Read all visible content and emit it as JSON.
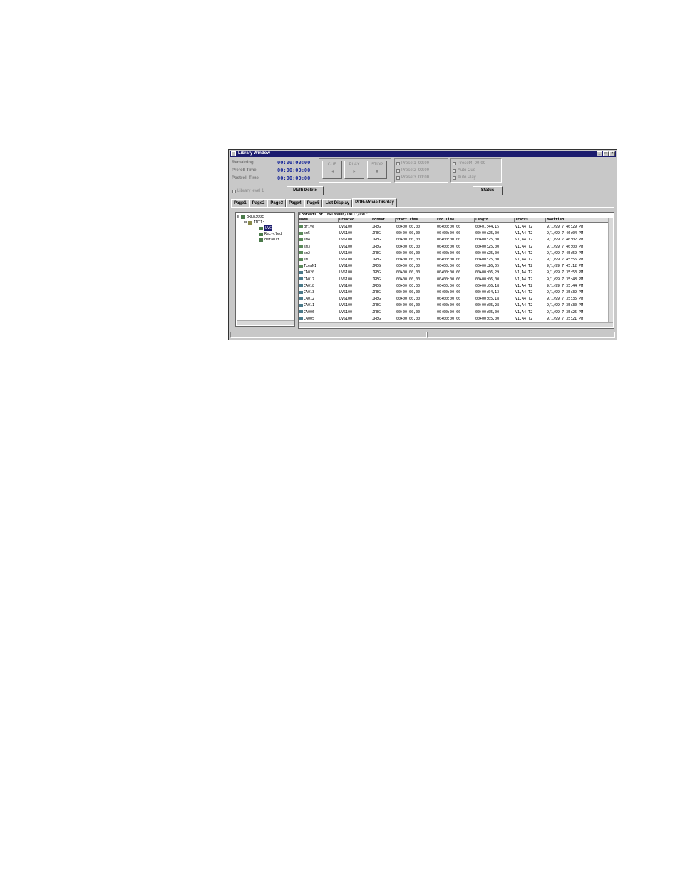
{
  "window": {
    "title": "Library Window",
    "controls": [
      "_",
      "□",
      "×"
    ]
  },
  "timecodes": [
    {
      "label": "Remaining",
      "value": "00:00:00:00"
    },
    {
      "label": "Preroll Time",
      "value": "00:00:00:00"
    },
    {
      "label": "Postroll Time",
      "value": "00:00:00:00"
    }
  ],
  "transport": [
    {
      "label": "CUE",
      "glyph": "|◂"
    },
    {
      "label": "PLAY",
      "glyph": "▸"
    },
    {
      "label": "STOP",
      "glyph": "■"
    }
  ],
  "presets_a": [
    {
      "label": "Preset1",
      "value": "00:00"
    },
    {
      "label": "Preset2",
      "value": "00:00"
    },
    {
      "label": "Preset3",
      "value": "00:00"
    }
  ],
  "presets_b": [
    {
      "label": "Preset4",
      "value": "00:00"
    },
    {
      "label": "Auto Cue"
    },
    {
      "label": "Auto Play"
    }
  ],
  "library_level": "Library level 1",
  "multi_delete_label": "Multi Delete",
  "status_label": "Status",
  "tabs": [
    "Page1",
    "Page2",
    "Page3",
    "Page4",
    "Page5",
    "List Display",
    "PDR-Movie Display"
  ],
  "tree": [
    {
      "label": "BRL8300E",
      "toggle": "⊟",
      "indent": 0
    },
    {
      "label": "INT1:",
      "toggle": "⊟",
      "indent": 1
    },
    {
      "label": "LVC",
      "indent": 2
    },
    {
      "label": "Recycled",
      "indent": 2
    },
    {
      "label": "default",
      "indent": 2
    }
  ],
  "list": {
    "path": "Contents of 'BRL8300E/INT1:/LVC'",
    "columns": [
      "Name",
      "Created",
      "Format",
      "Start Time",
      "End Time",
      "Length",
      "Tracks",
      "Modified"
    ],
    "rows": [
      [
        "drive",
        "LVS100",
        "JPEG",
        "00+00:00,00",
        "00+00:00,00",
        "00+01:44,15",
        "V1,A4,T2",
        "9/1/99 7:46:29 PM"
      ],
      [
        "sm5",
        "LVS100",
        "JPEG",
        "00+00:00,00",
        "00+00:00,00",
        "00+00:25,00",
        "V1,A4,T2",
        "9/1/99 7:46:04 PM"
      ],
      [
        "sm4",
        "LVS100",
        "JPEG",
        "00+00:00,00",
        "00+00:00,00",
        "00+00:25,00",
        "V1,A4,T2",
        "9/1/99 7:46:02 PM"
      ],
      [
        "sm3",
        "LVS100",
        "JPEG",
        "00+00:00,00",
        "00+00:00,00",
        "00+00:25,00",
        "V1,A4,T2",
        "9/1/99 7:46:00 PM"
      ],
      [
        "sm2",
        "LVS100",
        "JPEG",
        "00+00:00,00",
        "00+00:00,00",
        "00+00:25,00",
        "V1,A4,T2",
        "9/1/99 7:45:59 PM"
      ],
      [
        "sm1",
        "LVS100",
        "JPEG",
        "00+00:00,00",
        "00+00:00,00",
        "00+00:25,00",
        "V1,A4,T2",
        "9/1/99 7:45:56 PM"
      ],
      [
        "TLeaN1",
        "LVS100",
        "JPEG",
        "00+00:00,00",
        "00+00:00,00",
        "00+00:26,05",
        "V1,A4,T2",
        "9/1/99 7:45:12 PM"
      ],
      [
        "CA020",
        "LVS100",
        "JPEG",
        "00+00:00,00",
        "00+00:00,00",
        "00+00:06,29",
        "V1,A4,T2",
        "9/1/99 7:35:53 PM"
      ],
      [
        "CA017",
        "LVS100",
        "JPEG",
        "00+00:00,00",
        "00+00:00,00",
        "00+00:06,00",
        "V1,A4,T2",
        "9/1/99 7:35:48 PM"
      ],
      [
        "CA018",
        "LVS100",
        "JPEG",
        "00+00:00,00",
        "00+00:00,00",
        "00+00:06,18",
        "V1,A4,T2",
        "9/1/99 7:35:44 PM"
      ],
      [
        "CA013",
        "LVS100",
        "JPEG",
        "00+00:00,00",
        "00+00:00,00",
        "00+00:04,13",
        "V1,A4,T2",
        "9/1/99 7:35:39 PM"
      ],
      [
        "CA012",
        "LVS100",
        "JPEG",
        "00+00:00,00",
        "00+00:00,00",
        "00+00:05,18",
        "V1,A4,T2",
        "9/1/99 7:35:35 PM"
      ],
      [
        "CA011",
        "LVS100",
        "JPEG",
        "00+00:00,00",
        "00+00:00,00",
        "00+00:05,28",
        "V1,A4,T2",
        "9/1/99 7:35:30 PM"
      ],
      [
        "CA006",
        "LVS100",
        "JPEG",
        "00+00:00,00",
        "00+00:00,00",
        "00+00:05,00",
        "V1,A4,T2",
        "9/1/99 7:35:25 PM"
      ],
      [
        "CA005",
        "LVS100",
        "JPEG",
        "00+00:00,00",
        "00+00:00,00",
        "00+00:05,00",
        "V1,A4,T2",
        "9/1/99 7:35:21 PM"
      ]
    ]
  }
}
